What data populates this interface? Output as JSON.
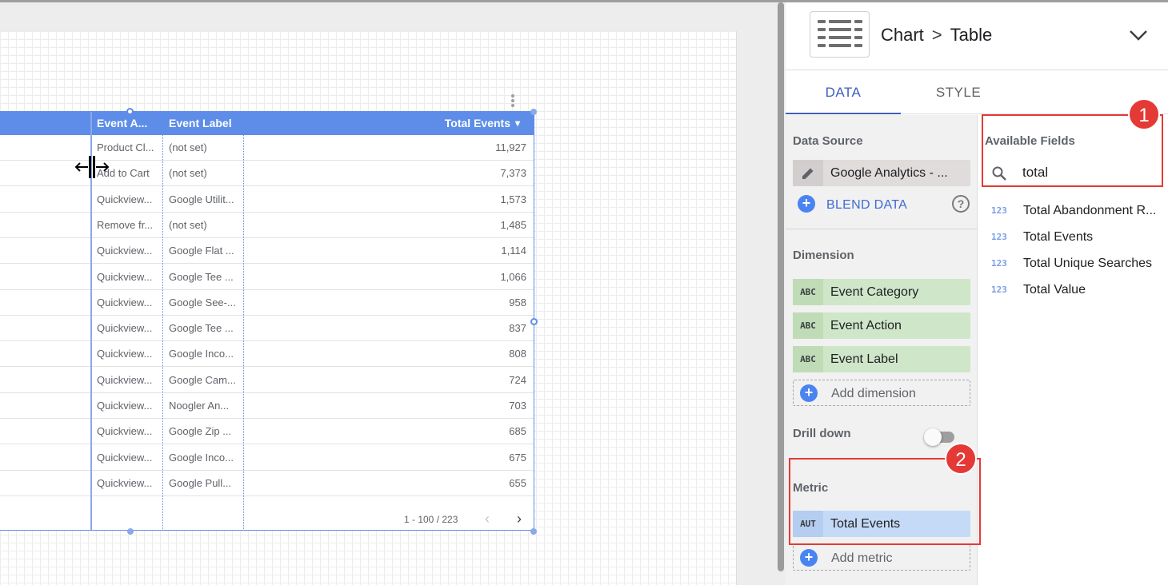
{
  "table": {
    "columns": {
      "event_action": "Event A...",
      "event_label": "Event Label",
      "total_events": "Total Events"
    },
    "sort_indicator": "▾",
    "rows": [
      {
        "action": "Product Cl...",
        "label": "(not set)",
        "total": "11,927"
      },
      {
        "action": "Add to Cart",
        "label": "(not set)",
        "total": "7,373"
      },
      {
        "action": "Quickview...",
        "label": "Google Utilit...",
        "total": "1,573"
      },
      {
        "action": "Remove fr...",
        "label": "(not set)",
        "total": "1,485"
      },
      {
        "action": "Quickview...",
        "label": "Google Flat ...",
        "total": "1,114"
      },
      {
        "action": "Quickview...",
        "label": "Google Tee ...",
        "total": "1,066"
      },
      {
        "action": "Quickview...",
        "label": "Google See-...",
        "total": "958"
      },
      {
        "action": "Quickview...",
        "label": "Google Tee ...",
        "total": "837"
      },
      {
        "action": "Quickview...",
        "label": "Google Inco...",
        "total": "808"
      },
      {
        "action": "Quickview...",
        "label": "Google Cam...",
        "total": "724"
      },
      {
        "action": "Quickview...",
        "label": "Noogler An...",
        "total": "703"
      },
      {
        "action": "Quickview...",
        "label": "Google Zip ...",
        "total": "685"
      },
      {
        "action": "Quickview...",
        "label": "Google Inco...",
        "total": "675"
      },
      {
        "action": "Quickview...",
        "label": "Google Pull...",
        "total": "655"
      }
    ],
    "pagination": "1 - 100 / 223",
    "prev_glyph": "‹",
    "next_glyph": "›"
  },
  "panel": {
    "breadcrumb": {
      "parent": "Chart",
      "separator": ">",
      "current": "Table"
    },
    "tabs": {
      "data": "DATA",
      "style": "STYLE"
    },
    "data_source": {
      "label": "Data Source",
      "value": "Google Analytics - ...",
      "blend_label": "BLEND DATA",
      "help_glyph": "?"
    },
    "dimension": {
      "label": "Dimension",
      "items": [
        {
          "tag": "ABC",
          "name": "Event Category"
        },
        {
          "tag": "ABC",
          "name": "Event Action"
        },
        {
          "tag": "ABC",
          "name": "Event Label"
        }
      ],
      "add_label": "Add dimension"
    },
    "drill_down": {
      "label": "Drill down",
      "enabled": false
    },
    "metric": {
      "label": "Metric",
      "items": [
        {
          "tag": "AUT",
          "name": "Total Events"
        }
      ],
      "add_label": "Add metric"
    },
    "available_fields": {
      "label": "Available Fields",
      "search_value": "total",
      "items": [
        {
          "tag": "123",
          "name": "Total Abandonment R..."
        },
        {
          "tag": "123",
          "name": "Total Events"
        },
        {
          "tag": "123",
          "name": "Total Unique Searches"
        },
        {
          "tag": "123",
          "name": "Total Value"
        }
      ]
    }
  },
  "annotations": {
    "badge_1": "1",
    "badge_2": "2"
  },
  "colors": {
    "table_header": "#5d8de8",
    "dimension_chip": "#cfe6c9",
    "metric_chip": "#c5daf7",
    "accent": "#3f5fb8",
    "annotation": "#e53935"
  }
}
